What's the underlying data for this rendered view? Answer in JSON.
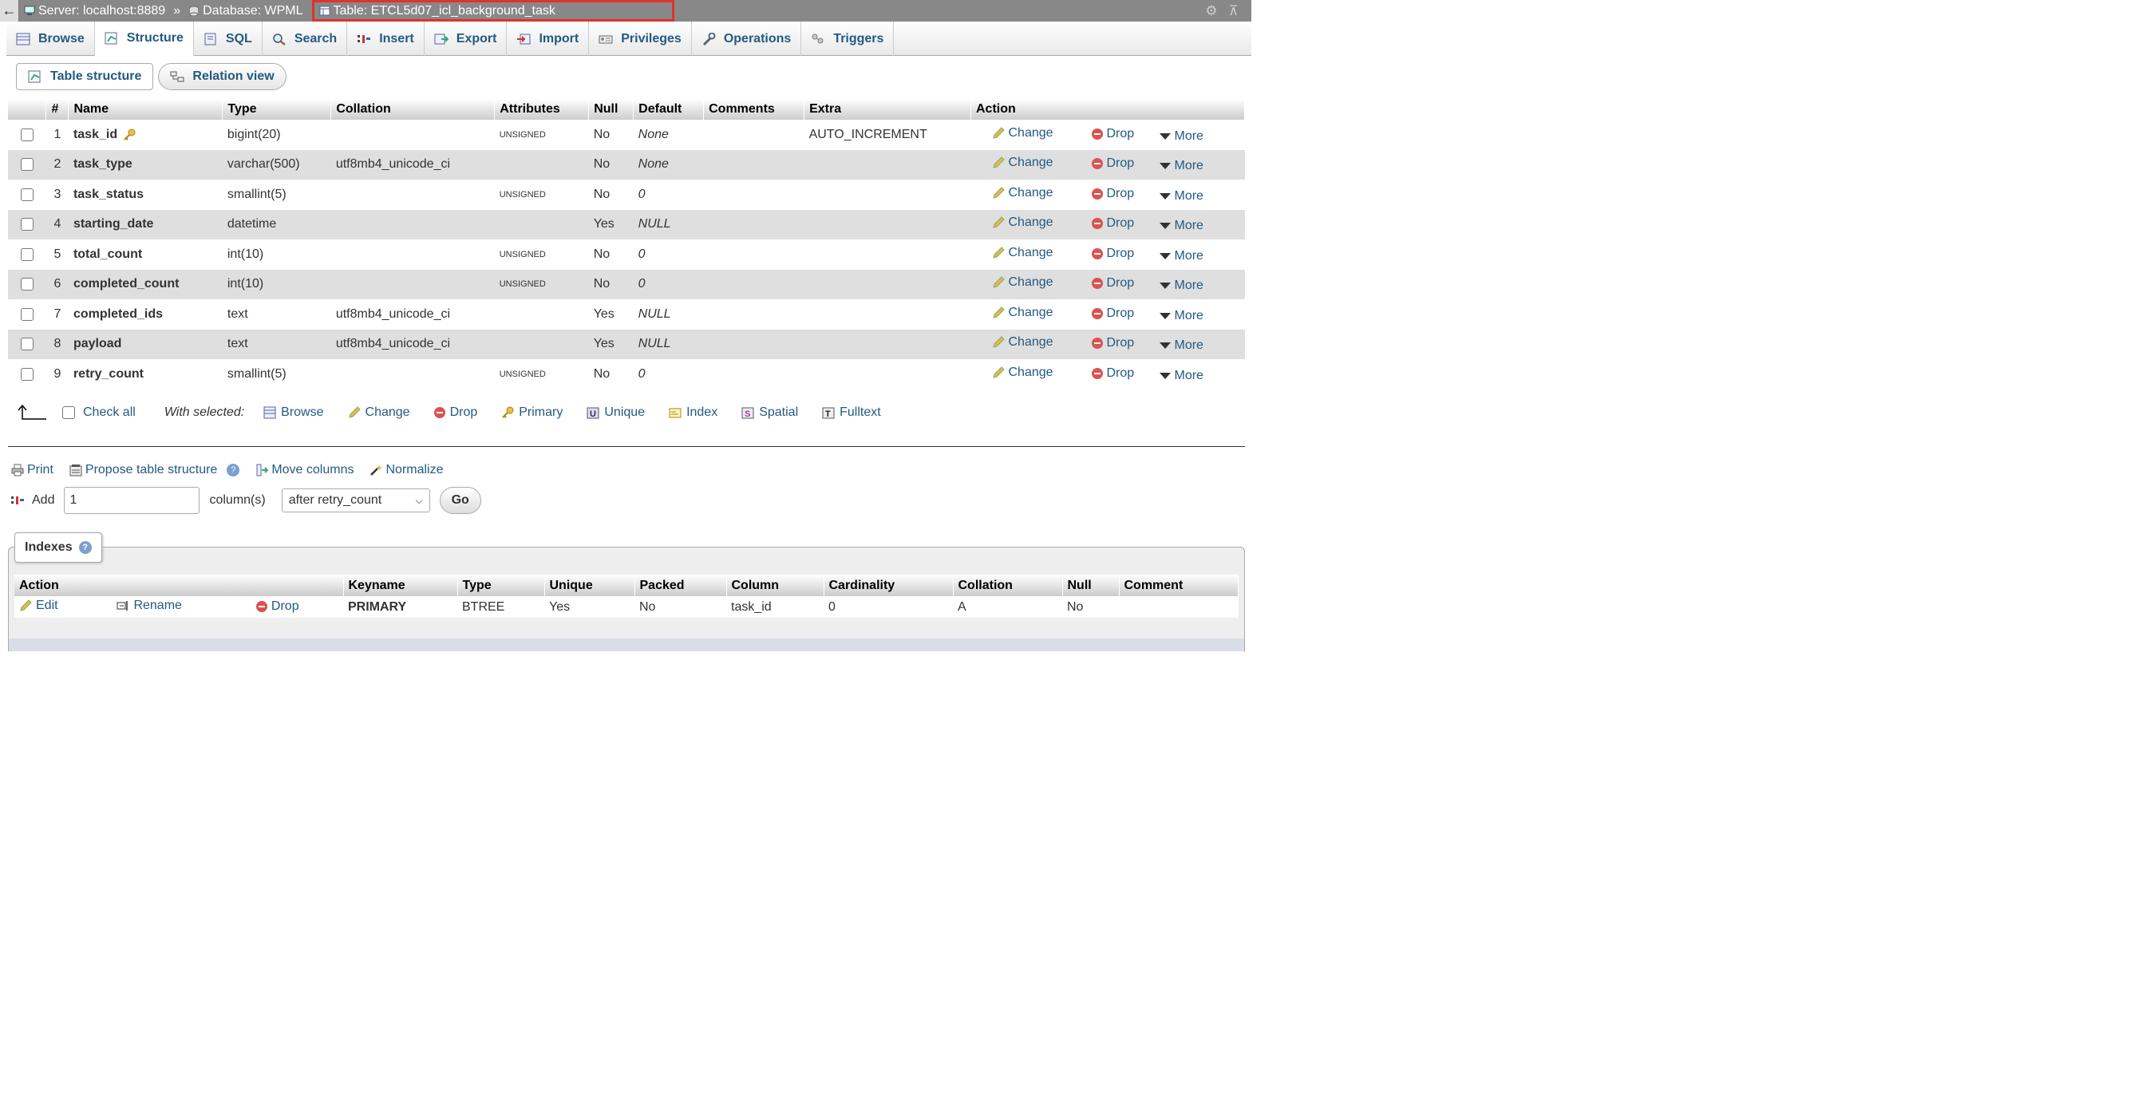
{
  "breadcrumb": {
    "server": "Server: localhost:8889",
    "separator": "»",
    "database": "Database: WPML",
    "table": "Table: ETCL5d07_icl_background_task"
  },
  "tabs": [
    {
      "label": "Browse",
      "icon": "browse-icon"
    },
    {
      "label": "Structure",
      "icon": "structure-icon",
      "active": true
    },
    {
      "label": "SQL",
      "icon": "sql-icon"
    },
    {
      "label": "Search",
      "icon": "search-icon"
    },
    {
      "label": "Insert",
      "icon": "insert-icon"
    },
    {
      "label": "Export",
      "icon": "export-icon"
    },
    {
      "label": "Import",
      "icon": "import-icon"
    },
    {
      "label": "Privileges",
      "icon": "privileges-icon"
    },
    {
      "label": "Operations",
      "icon": "operations-icon"
    },
    {
      "label": "Triggers",
      "icon": "triggers-icon"
    }
  ],
  "subtabs": {
    "table_structure": "Table structure",
    "relation_view": "Relation view"
  },
  "structure": {
    "headers": [
      "#",
      "Name",
      "Type",
      "Collation",
      "Attributes",
      "Null",
      "Default",
      "Comments",
      "Extra",
      "Action"
    ],
    "actions": {
      "change": "Change",
      "drop": "Drop",
      "more": "More"
    },
    "rows": [
      {
        "num": "1",
        "name": "task_id",
        "type": "bigint(20)",
        "collation": "",
        "attributes": "UNSIGNED",
        "null": "No",
        "default": "None",
        "comments": "",
        "extra": "AUTO_INCREMENT",
        "key": true
      },
      {
        "num": "2",
        "name": "task_type",
        "type": "varchar(500)",
        "collation": "utf8mb4_unicode_ci",
        "attributes": "",
        "null": "No",
        "default": "None",
        "comments": "",
        "extra": ""
      },
      {
        "num": "3",
        "name": "task_status",
        "type": "smallint(5)",
        "collation": "",
        "attributes": "UNSIGNED",
        "null": "No",
        "default": "0",
        "comments": "",
        "extra": ""
      },
      {
        "num": "4",
        "name": "starting_date",
        "type": "datetime",
        "collation": "",
        "attributes": "",
        "null": "Yes",
        "default": "NULL",
        "comments": "",
        "extra": ""
      },
      {
        "num": "5",
        "name": "total_count",
        "type": "int(10)",
        "collation": "",
        "attributes": "UNSIGNED",
        "null": "No",
        "default": "0",
        "comments": "",
        "extra": ""
      },
      {
        "num": "6",
        "name": "completed_count",
        "type": "int(10)",
        "collation": "",
        "attributes": "UNSIGNED",
        "null": "No",
        "default": "0",
        "comments": "",
        "extra": ""
      },
      {
        "num": "7",
        "name": "completed_ids",
        "type": "text",
        "collation": "utf8mb4_unicode_ci",
        "attributes": "",
        "null": "Yes",
        "default": "NULL",
        "comments": "",
        "extra": ""
      },
      {
        "num": "8",
        "name": "payload",
        "type": "text",
        "collation": "utf8mb4_unicode_ci",
        "attributes": "",
        "null": "Yes",
        "default": "NULL",
        "comments": "",
        "extra": ""
      },
      {
        "num": "9",
        "name": "retry_count",
        "type": "smallint(5)",
        "collation": "",
        "attributes": "UNSIGNED",
        "null": "No",
        "default": "0",
        "comments": "",
        "extra": ""
      }
    ]
  },
  "with_selected": {
    "check_all": "Check all",
    "label": "With selected:",
    "items": [
      "Browse",
      "Change",
      "Drop",
      "Primary",
      "Unique",
      "Index",
      "Spatial",
      "Fulltext"
    ]
  },
  "tools": {
    "print": "Print",
    "propose": "Propose table structure",
    "move": "Move columns",
    "normalize": "Normalize"
  },
  "add": {
    "label": "Add",
    "value": "1",
    "unit": "column(s)",
    "position": "after retry_count",
    "go": "Go"
  },
  "indexes": {
    "legend": "Indexes",
    "headers": [
      "Action",
      "Keyname",
      "Type",
      "Unique",
      "Packed",
      "Column",
      "Cardinality",
      "Collation",
      "Null",
      "Comment"
    ],
    "actions": {
      "edit": "Edit",
      "rename": "Rename",
      "drop": "Drop"
    },
    "row": {
      "keyname": "PRIMARY",
      "type": "BTREE",
      "unique": "Yes",
      "packed": "No",
      "column": "task_id",
      "cardinality": "0",
      "collation": "A",
      "null": "No",
      "comment": ""
    }
  }
}
